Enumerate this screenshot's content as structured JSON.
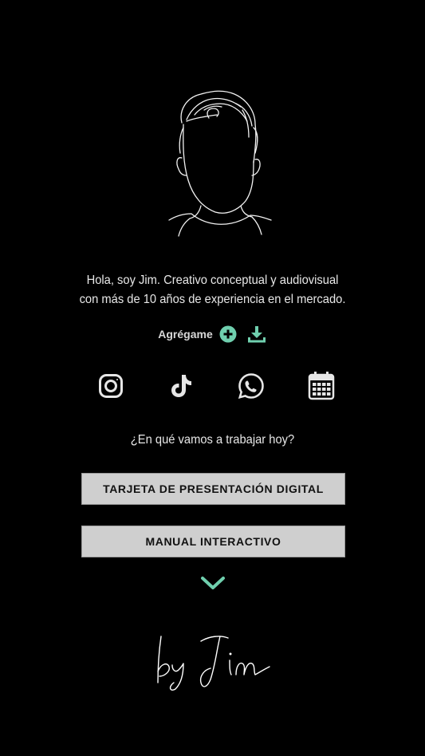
{
  "profile": {
    "intro_line1": "Hola, soy Jim. Creativo conceptual y audiovisual",
    "intro_line2": "con más de 10 años de experiencia en el mercado."
  },
  "add_contact": {
    "label": "Agrégame",
    "add_icon": "plus-circle-icon",
    "download_icon": "download-icon"
  },
  "socials": [
    {
      "name": "instagram",
      "icon": "instagram-icon"
    },
    {
      "name": "tiktok",
      "icon": "tiktok-icon"
    },
    {
      "name": "whatsapp",
      "icon": "whatsapp-icon"
    },
    {
      "name": "calendar",
      "icon": "calendar-icon"
    }
  ],
  "question": "¿En qué vamos a trabajar hoy?",
  "menu": {
    "buttons": [
      {
        "label": "TARJETA DE PRESENTACIÓN DIGITAL"
      },
      {
        "label": "MANUAL INTERACTIVO"
      }
    ]
  },
  "colors": {
    "background": "#000000",
    "accent": "#6fcfae",
    "button_bg": "#cfcfcf",
    "text": "#e8e8e8"
  }
}
